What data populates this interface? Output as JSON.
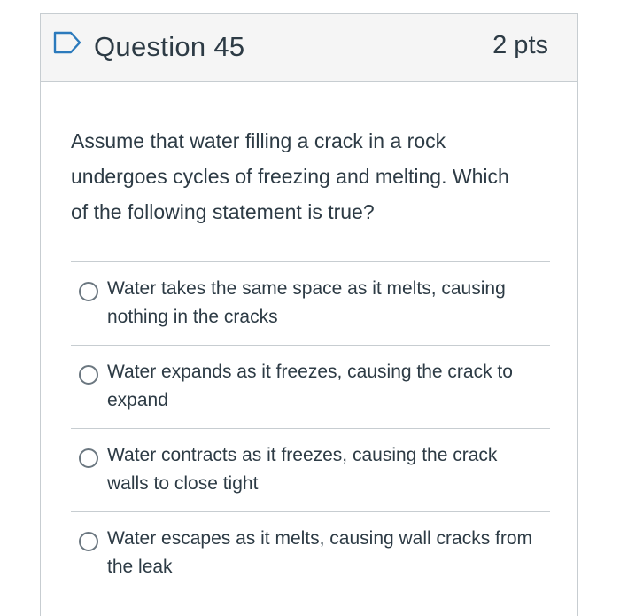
{
  "question": {
    "title": "Question 45",
    "points": "2 pts",
    "flag_icon": "flag-outline-icon",
    "text": "Assume that water filling a crack in a rock undergoes cycles of freezing and melting. Which of the following statement is true?",
    "answers": [
      {
        "label": "Water takes the same space as it melts, causing nothing in the cracks"
      },
      {
        "label": "Water expands as it freezes, causing the crack to expand"
      },
      {
        "label": "Water contracts as it freezes, causing the crack walls to close tight"
      },
      {
        "label": "Water escapes as it melts, causing wall cracks from the leak"
      }
    ]
  },
  "colors": {
    "text": "#2d3b45",
    "header_bg": "#f5f5f5",
    "border": "#c7cdd1",
    "flag": "#2b7abc"
  }
}
